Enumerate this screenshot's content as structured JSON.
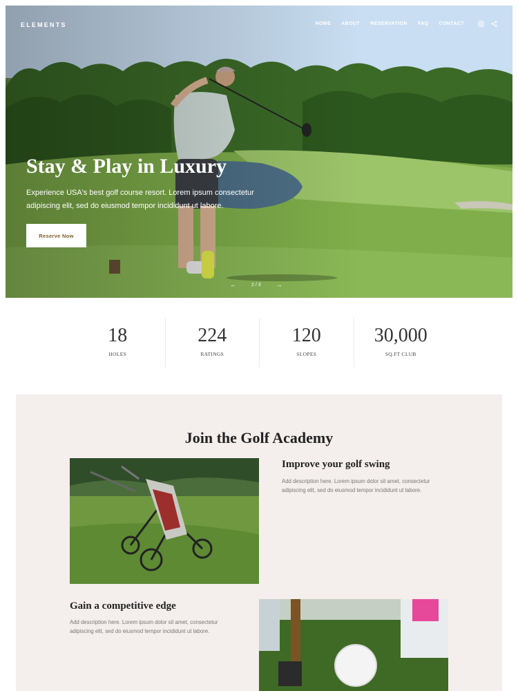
{
  "brand": {
    "logo": "ELEMENTS"
  },
  "nav": {
    "items": [
      "HOME",
      "ABOUT",
      "RESERVATION",
      "FAQ",
      "CONTACT"
    ],
    "social_icons": [
      "instagram-icon",
      "share-icon"
    ]
  },
  "hero": {
    "title": "Stay & Play in Luxury",
    "subtitle": "Experience USA's best golf course resort. Lorem ipsum consectetur adipiscing elit, sed do eiusmod tempor incididunt ut labore.",
    "cta_label": "Reserve Now",
    "pager": {
      "prev": "←",
      "position": "2 / 3",
      "next": "→"
    }
  },
  "stats": [
    {
      "value": "18",
      "label": "HOLES"
    },
    {
      "value": "224",
      "label": "RATINGS"
    },
    {
      "value": "120",
      "label": "SLOPES"
    },
    {
      "value": "30,000",
      "label": "SQ.FT CLUB"
    }
  ],
  "academy": {
    "title": "Join the Golf Academy",
    "features": [
      {
        "heading": "Improve your golf swing",
        "text": "Add description here. Lorem ipsum dolor sit amet, consectetur adipiscing elit, sed do eiusmod tempor incididunt ut labore."
      },
      {
        "heading": "Gain a competitive edge",
        "text": "Add description here. Lorem ipsum dolor sit amet, consectetur adipiscing elit, sed do eiusmod tempor incididunt ut labore."
      }
    ]
  },
  "colors": {
    "cta_text": "#7a5a28",
    "academy_bg": "#f4eeec",
    "hero_text": "#ffffff"
  }
}
